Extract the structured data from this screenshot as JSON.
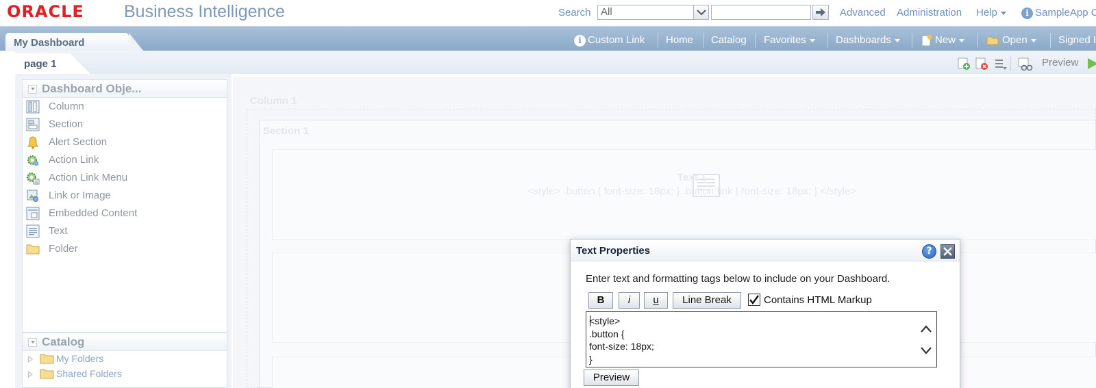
{
  "header": {
    "logo": "ORACLE",
    "product": "Business Intelligence",
    "search_label": "Search",
    "search_scope": "All",
    "search_query": "",
    "links": {
      "advanced": "Advanced",
      "administration": "Administration",
      "help": "Help",
      "user": "SampleApp C"
    }
  },
  "nav": {
    "dashboard_tab": "My Dashboard",
    "custom_link": "Custom Link",
    "home": "Home",
    "catalog": "Catalog",
    "favorites": "Favorites",
    "dashboards": "Dashboards",
    "new": "New",
    "open": "Open",
    "signed": "Signed I"
  },
  "page": {
    "tab": "page 1",
    "preview": "Preview"
  },
  "objects_panel": {
    "title": "Dashboard Obje...",
    "items": [
      {
        "label": "Column",
        "icon": "column-icon"
      },
      {
        "label": "Section",
        "icon": "section-icon"
      },
      {
        "label": "Alert Section",
        "icon": "bell-icon"
      },
      {
        "label": "Action Link",
        "icon": "gear-link-icon"
      },
      {
        "label": "Action Link Menu",
        "icon": "gear-menu-icon"
      },
      {
        "label": "Link or Image",
        "icon": "link-image-icon"
      },
      {
        "label": "Embedded Content",
        "icon": "embed-icon"
      },
      {
        "label": "Text",
        "icon": "text-icon"
      },
      {
        "label": "Folder",
        "icon": "folder-icon"
      }
    ]
  },
  "catalog_panel": {
    "title": "Catalog",
    "items": [
      "My Folders",
      "Shared Folders"
    ]
  },
  "canvas": {
    "column_label": "Column 1",
    "section_label": "Section 1",
    "text_title": "Text 1",
    "text_content": "<style> .button { font-size: 18px; } .button:link { font-size: 18px; } </style>"
  },
  "dialog": {
    "title": "Text Properties",
    "help": "?",
    "instructions": "Enter text and formatting tags below to include on your Dashboard.",
    "bold": "B",
    "italic": "i",
    "underline": "u",
    "line_break": "Line Break",
    "html_markup_label": "Contains HTML Markup",
    "html_markup_checked": true,
    "content": "<style>\n.button {\nfont-size: 18px;\n}",
    "preview": "Preview"
  },
  "colors": {
    "oracle_red": "#e21f26",
    "nav_blue": "#8aa8c8",
    "link_blue": "#6f91bd"
  }
}
